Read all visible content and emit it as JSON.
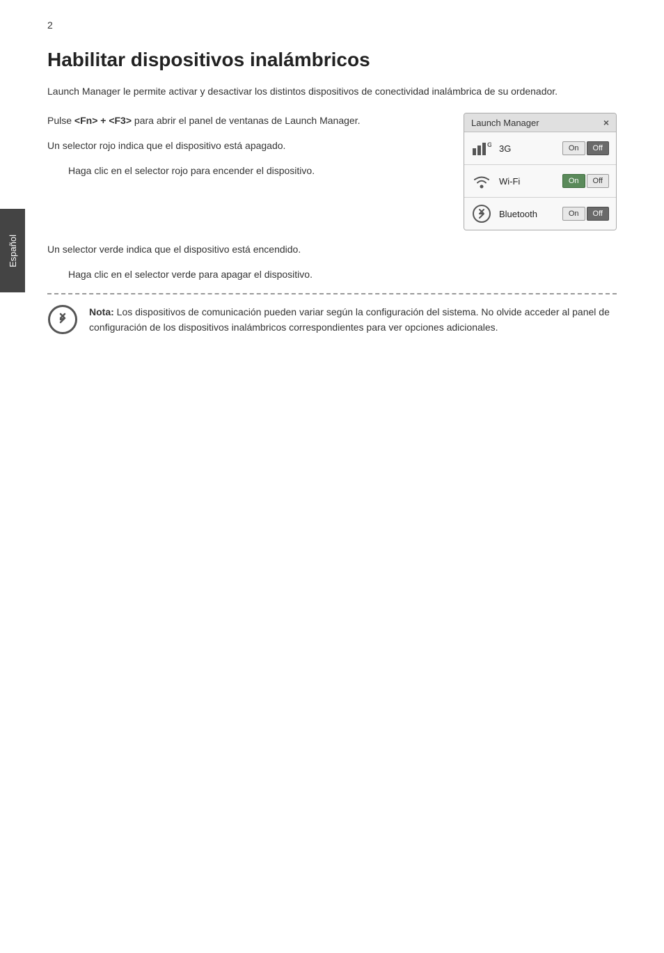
{
  "page": {
    "number": "2",
    "sidebar_label": "Español"
  },
  "heading": "Habilitar dispositivos inalámbricos",
  "intro": "Launch Manager le permite activar y desactivar los distintos dispositivos de conectividad inalámbrica de su ordenador.",
  "paragraphs": {
    "pulse": "Pulse <Fn> + <F3> para abrir el panel de ventanas de Launch Manager.",
    "red_selector": "Un selector rojo indica que el dispositivo está apagado.",
    "red_action": "Haga clic en el selector rojo para encender el dispositivo.",
    "green_selector": "Un selector verde indica que el dispositivo está encendido.",
    "green_action": "Haga clic en el selector verde para apagar el dispositivo."
  },
  "launch_manager": {
    "title": "Launch Manager",
    "close_label": "×",
    "devices": [
      {
        "name": "3G",
        "icon": "3g",
        "on_label": "On",
        "off_label": "Off",
        "on_active": false,
        "off_active": true
      },
      {
        "name": "Wi-Fi",
        "icon": "wifi",
        "on_label": "On",
        "off_label": "Off",
        "on_active": true,
        "off_active": false
      },
      {
        "name": "Bluetooth",
        "icon": "bluetooth",
        "on_label": "On",
        "off_label": "Off",
        "on_active": false,
        "off_active": true
      }
    ]
  },
  "note": {
    "bold": "Nota:",
    "text": " Los dispositivos de comunicación pueden variar según la configuración del sistema. No olvide acceder al panel de configuración de los dispositivos inalámbricos correspondientes para ver opciones adicionales."
  }
}
